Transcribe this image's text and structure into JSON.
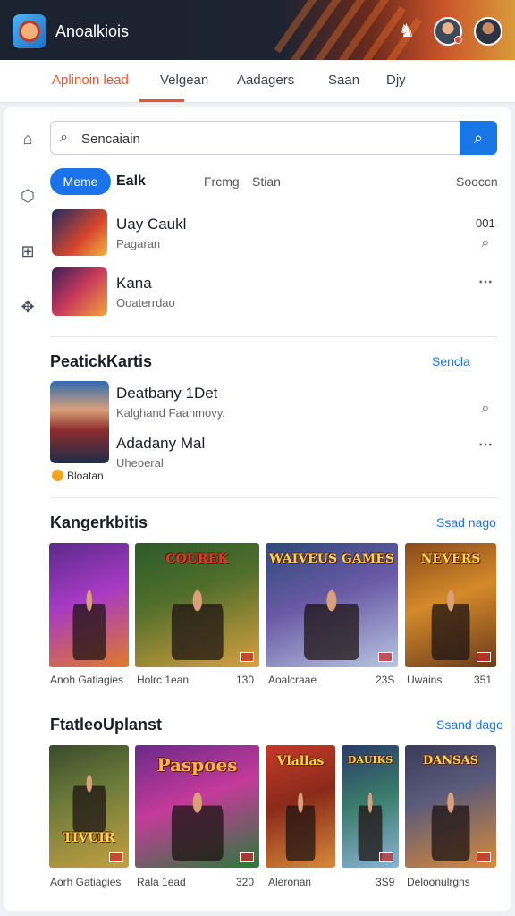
{
  "header": {
    "app_title": "Anoalkiois",
    "icons": [
      "app-logo",
      "mask-icon",
      "avatar-user",
      "avatar-profile"
    ]
  },
  "tabs": [
    {
      "label": "Aplinoin lead",
      "active": true
    },
    {
      "label": "Velgean"
    },
    {
      "label": "Aadagers"
    },
    {
      "label": "Saan"
    },
    {
      "label": "Djy"
    }
  ],
  "sidebar": [
    "home-icon",
    "game-icon",
    "grid-icon",
    "puzzle-icon"
  ],
  "search": {
    "value": "Sencaiain",
    "button_icon": "search-icon"
  },
  "filters": {
    "pill": "Meme",
    "bold": "Ealk",
    "items": [
      "Frcmg",
      "Stian"
    ],
    "right": "Sooccn"
  },
  "list1": [
    {
      "title": "Uay Caukl",
      "subtitle": "Pagaran",
      "meta": "001"
    },
    {
      "title": "Kana",
      "subtitle": "Ooaterrdao",
      "meta": ""
    }
  ],
  "section1": {
    "title": "PeatickKartis",
    "link": "Sencla",
    "rows": [
      {
        "title": "Deatbany 1Det",
        "subtitle": "Kalghand Faahmovy."
      },
      {
        "title": "Adadany Mal",
        "subtitle": "Uheoeral"
      }
    ],
    "badge": "Bloatan"
  },
  "section2": {
    "title": "Kangerkbitis",
    "link": "Ssad nago",
    "posters": [
      {
        "title": ""
      },
      {
        "title": "COUREK"
      },
      {
        "title": "WAIVEUS GAMES"
      },
      {
        "title": "NEVERS"
      }
    ],
    "captions": [
      "Anoh Gatiagies",
      "Holrc 1ean",
      "130",
      "Aoalcraae",
      "23S",
      "Uwains",
      "351"
    ]
  },
  "section3": {
    "title": "FtatleoUplanst",
    "link": "Ssand dago",
    "posters": [
      {
        "title": "TIVUIR"
      },
      {
        "title": "Paspoes"
      },
      {
        "title": "Vlallas"
      },
      {
        "title": "DAUIKS"
      },
      {
        "title": "DANSAS"
      }
    ],
    "captions": [
      "Aorh Gatiagies",
      "Rala 1ead",
      "320",
      "Aleronan",
      "3S9",
      "Deloonulrgns"
    ]
  }
}
